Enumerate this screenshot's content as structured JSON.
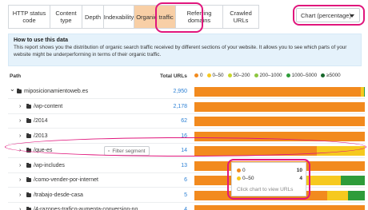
{
  "tabs": [
    {
      "label": "HTTP status code",
      "active": false
    },
    {
      "label": "Content type",
      "active": false
    },
    {
      "label": "Depth",
      "active": false
    },
    {
      "label": "Indexability",
      "active": false
    },
    {
      "label": "Organic traffic",
      "active": true
    },
    {
      "label": "Referring domains",
      "active": false
    },
    {
      "label": "Crawled URLs",
      "active": false
    }
  ],
  "chart_select": {
    "value": "Chart (percentage)"
  },
  "info": {
    "title": "How to use this data",
    "text": "This report shows you the distribution of organic search traffic received by different sections of your website. It allows you to see which parts of your website might be underperforming in terms of their organic traffic."
  },
  "table": {
    "col_path": "Path",
    "col_total": "Total URLs"
  },
  "legend": [
    {
      "label": "0",
      "color": "#f28a1e"
    },
    {
      "label": "0–50",
      "color": "#f6c91f"
    },
    {
      "label": "50–200",
      "color": "#c6d62c"
    },
    {
      "label": "200–1000",
      "color": "#8cc63f"
    },
    {
      "label": "1000–5000",
      "color": "#2e9c3a"
    },
    {
      "label": "≥5000",
      "color": "#17672b"
    }
  ],
  "colors": {
    "zero": "#f28a1e",
    "low": "#f6c91f",
    "mid": "#c6d62c",
    "mid2": "#8cc63f",
    "high": "#2e9c3a",
    "top": "#17672b",
    "link": "#2a7fd4",
    "highlight": "#e0167c",
    "active_tab": "#f8cfa6"
  },
  "rows": [
    {
      "name": "miposicionamientoweb.es",
      "count": "2,950",
      "expanded": true,
      "segments": [
        0.978,
        0.018,
        0.004
      ]
    },
    {
      "name": "/wp-content",
      "count": "2,178",
      "expanded": false,
      "segments": [
        1.0,
        0,
        0
      ]
    },
    {
      "name": "/2014",
      "count": "62",
      "expanded": false,
      "segments": [
        1.0,
        0,
        0
      ]
    },
    {
      "name": "/2013",
      "count": "16",
      "expanded": false,
      "segments": [
        1.0,
        0,
        0
      ]
    },
    {
      "name": "/que-es",
      "count": "14",
      "expanded": false,
      "segments": [
        0.72,
        0.28,
        0
      ]
    },
    {
      "name": "/wp-includes",
      "count": "13",
      "expanded": false,
      "segments": [
        1.0,
        0,
        0
      ]
    },
    {
      "name": "/como-vender-por-internet",
      "count": "6",
      "expanded": false,
      "segments": [
        0.64,
        0.22,
        0.14
      ]
    },
    {
      "name": "/trabajo-desde-casa",
      "count": "5",
      "expanded": false,
      "segments": [
        0.78,
        0.12,
        0.1
      ]
    },
    {
      "name": "/4-razones-trafico-aumenta-conversion-no",
      "count": "4",
      "expanded": false,
      "segments": [
        1.0,
        0,
        0
      ]
    }
  ],
  "filter_segment": {
    "label": "Filter segment"
  },
  "tooltip": {
    "rows": [
      {
        "label": "0",
        "value": "10",
        "color": "#f28a1e"
      },
      {
        "label": "0–50",
        "value": "4",
        "color": "#f6c91f"
      }
    ],
    "footer": "Click chart to view URLs"
  }
}
